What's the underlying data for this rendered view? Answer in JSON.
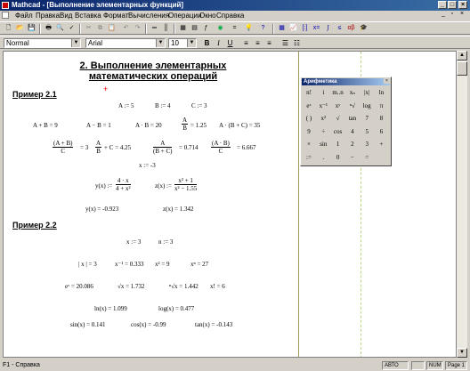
{
  "window": {
    "title": "Mathcad - [Выполнение элементарных функций]"
  },
  "menu": [
    "Файл",
    "Правка",
    "Вид",
    "Вставка",
    "Формат",
    "Вычисления",
    "Операции",
    "Окно",
    "Справка"
  ],
  "format_bar": {
    "style": "Normal",
    "font": "Arial",
    "size": "10"
  },
  "worksheet": {
    "heading_line1": "2. Выполнение элементарных",
    "heading_line2": "математических операций",
    "section1": "Пример 2.1",
    "section2": "Пример 2.2",
    "cursor": "+",
    "eq": {
      "a_def": "A := 5",
      "b_def": "B := 4",
      "c_def": "C := 3",
      "apb": "A + B = 9",
      "amb": "A − B = 1",
      "atb": "A · B = 20",
      "adb_num": "A",
      "adb_den": "B",
      "adb_res": "= 1.25",
      "abc": "A · (B + C) = 35",
      "f1_num": "(A + B)",
      "f1_den": "C",
      "f1_res": "= 3",
      "f2_num": "A",
      "f2_den": "B",
      "f2_rest": "+ C = 4.25",
      "f3_num": "A",
      "f3_den": "(B + C)",
      "f3_res": "= 0.714",
      "f4_num": "(A · B)",
      "f4_den": "C",
      "f4_res": "= 6.667",
      "x_def1": "x := -3",
      "y_lhs": "y(x) :=",
      "y_num": "4 · x",
      "y_den": "4 + x²",
      "z_lhs": "z(x) :=",
      "z_num": "x² + 1",
      "z_den": "x² − 1.55",
      "y_val": "y(x) = -0.923",
      "z_val": "z(x) = 1.342",
      "x_def2": "x := 3",
      "n_def": "n := 3",
      "absx": "| x | = 3",
      "xinv": "x⁻¹ = 0.333",
      "xsq": "x² = 9",
      "xn": "xⁿ = 27",
      "ex": "eˣ = 20.086",
      "sqrtx": "√x = 1.732",
      "nroot": "ⁿ√x = 1.442",
      "fact": "x! = 6",
      "ln": "ln(x) = 1.099",
      "log": "log(x) = 0.477",
      "sin": "sin(x) = 0.141",
      "cos": "cos(x) = -0.99",
      "tan": "tan(x) = -0.143"
    }
  },
  "palette": {
    "title": "Арифметика",
    "keys": [
      "n!",
      "i",
      "m..n",
      "xₙ",
      "|x|",
      "ln",
      "eˣ",
      "x⁻¹",
      "xʸ",
      "ⁿ√",
      "log",
      "π",
      "( )",
      "x²",
      "√",
      "tan",
      "7",
      "8",
      "9",
      "÷",
      "cos",
      "4",
      "5",
      "6",
      "×",
      "sin",
      "1",
      "2",
      "3",
      "+",
      ":=",
      ".",
      "0",
      "−",
      "="
    ]
  },
  "status": {
    "help": "F1 - Справка",
    "mode": "АВТО",
    "num": "NUM",
    "page": "Page 1"
  }
}
